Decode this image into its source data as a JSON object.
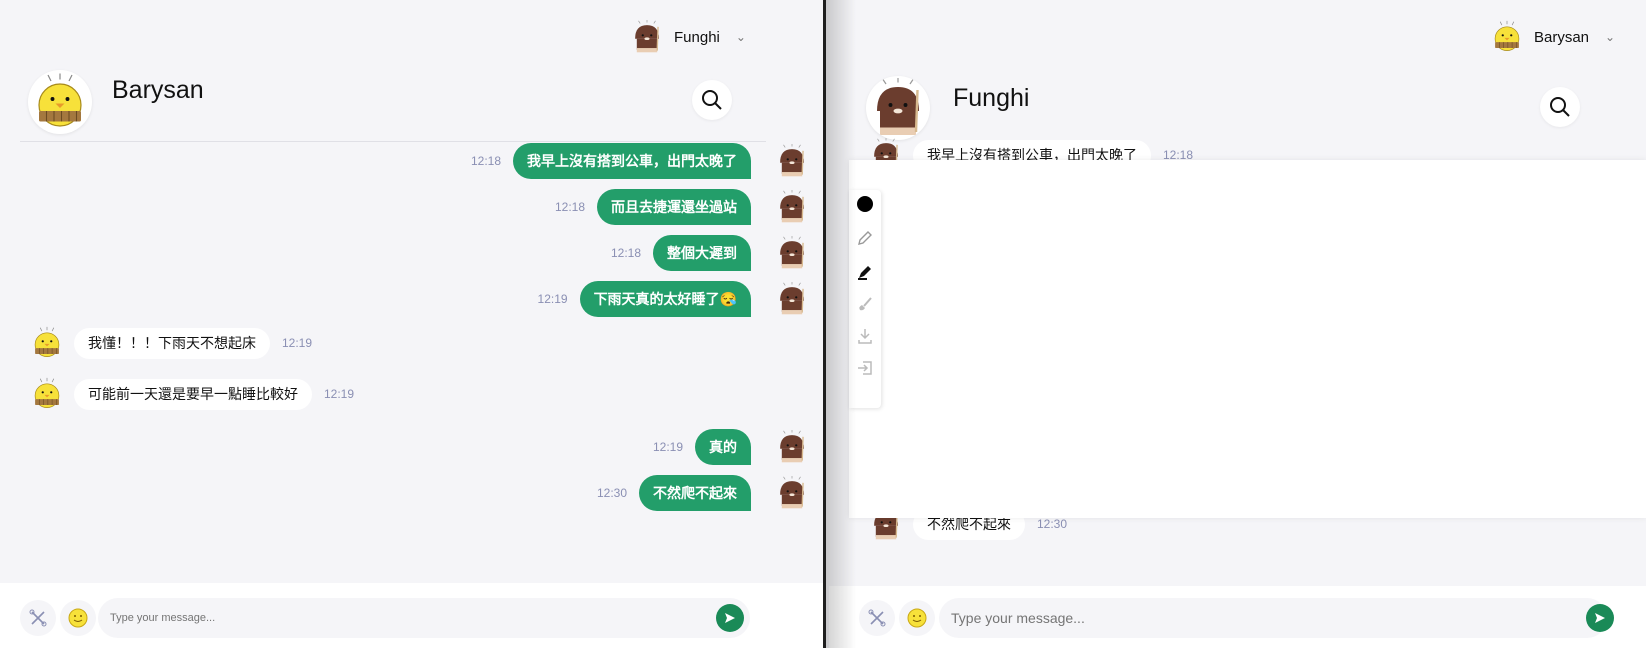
{
  "left": {
    "user_menu": {
      "name": "Funghi"
    },
    "chat": {
      "title": "Barysan"
    },
    "messages": [
      {
        "dir": "out",
        "text": "我早上沒有搭到公車，出門太晚了",
        "time": "12:18"
      },
      {
        "dir": "out",
        "text": "而且去捷運還坐過站",
        "time": "12:18"
      },
      {
        "dir": "out",
        "text": "整個大遲到",
        "time": "12:18"
      },
      {
        "dir": "out",
        "text": "下雨天真的太好睡了😪",
        "time": "12:19"
      },
      {
        "dir": "in",
        "text": "我懂！！！下雨天不想起床",
        "time": "12:19"
      },
      {
        "dir": "in",
        "text": "可能前一天還是要早一點睡比較好",
        "time": "12:19"
      },
      {
        "dir": "out",
        "text": "真的",
        "time": "12:19"
      },
      {
        "dir": "out",
        "text": "不然爬不起來",
        "time": "12:30"
      }
    ],
    "composer": {
      "placeholder": "Type your message..."
    }
  },
  "right": {
    "user_menu": {
      "name": "Barysan"
    },
    "chat": {
      "title": "Funghi"
    },
    "messages_partial": [
      {
        "text": "我早上沒有搭到公車，出門太晚了",
        "time": "12:18"
      },
      {
        "text": "不然爬不起來",
        "time": "12:30"
      }
    ],
    "composer": {
      "placeholder": "Type your message..."
    }
  },
  "whiteboard": {
    "tools": [
      "color-picker",
      "pencil",
      "marker",
      "eraser",
      "download",
      "exit"
    ],
    "current_color": "#000000"
  },
  "colors": {
    "outgoing_bubble": "#239e6a",
    "send_button": "#1a8a57",
    "timestamp": "#8a8fb3",
    "background": "#f5f5f8"
  },
  "icons": {
    "tools": "tools-icon",
    "emoji": "emoji-icon",
    "send": "send-icon",
    "search": "search-icon"
  }
}
